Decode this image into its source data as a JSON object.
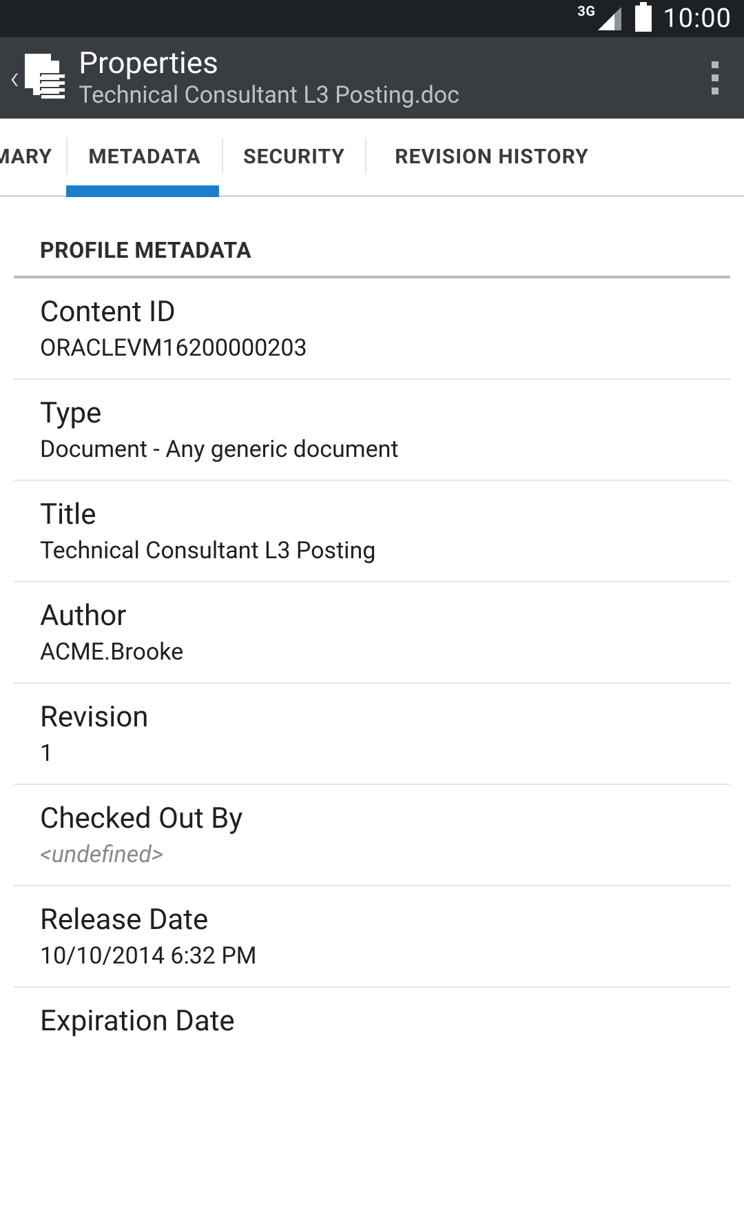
{
  "status_bar": {
    "network": "3G",
    "time": "10:00"
  },
  "app_bar": {
    "title": "Properties",
    "subtitle": "Technical Consultant L3 Posting.doc"
  },
  "tabs": {
    "summary": "SUMMARY",
    "metadata": "METADATA",
    "security": "SECURITY",
    "revision_history": "REVISION HISTORY",
    "active": "metadata"
  },
  "section": {
    "heading": "PROFILE METADATA",
    "items": [
      {
        "label": "Content ID",
        "value": "ORACLEVM16200000203"
      },
      {
        "label": "Type",
        "value": "Document - Any generic document"
      },
      {
        "label": "Title",
        "value": "Technical Consultant L3 Posting"
      },
      {
        "label": "Author",
        "value": "ACME.Brooke"
      },
      {
        "label": "Revision",
        "value": "1"
      },
      {
        "label": "Checked Out By",
        "value": "<undefined>",
        "undefined": true
      },
      {
        "label": "Release Date",
        "value": "10/10/2014 6:32 PM"
      },
      {
        "label": "Expiration Date",
        "value": ""
      }
    ]
  }
}
